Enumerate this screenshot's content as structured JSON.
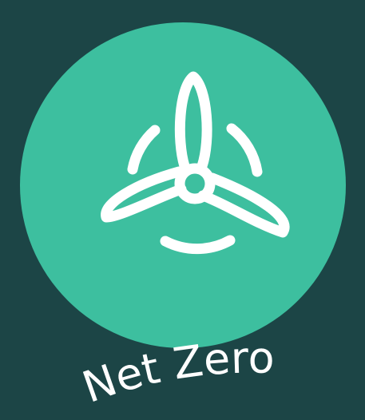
{
  "badge": {
    "caption": "Net Zero",
    "icon": "wind-turbine-icon",
    "colors": {
      "background": "#1c4546",
      "circle": "#3dbf9f",
      "icon": "#ffffff",
      "caption": "#ffffff"
    }
  }
}
